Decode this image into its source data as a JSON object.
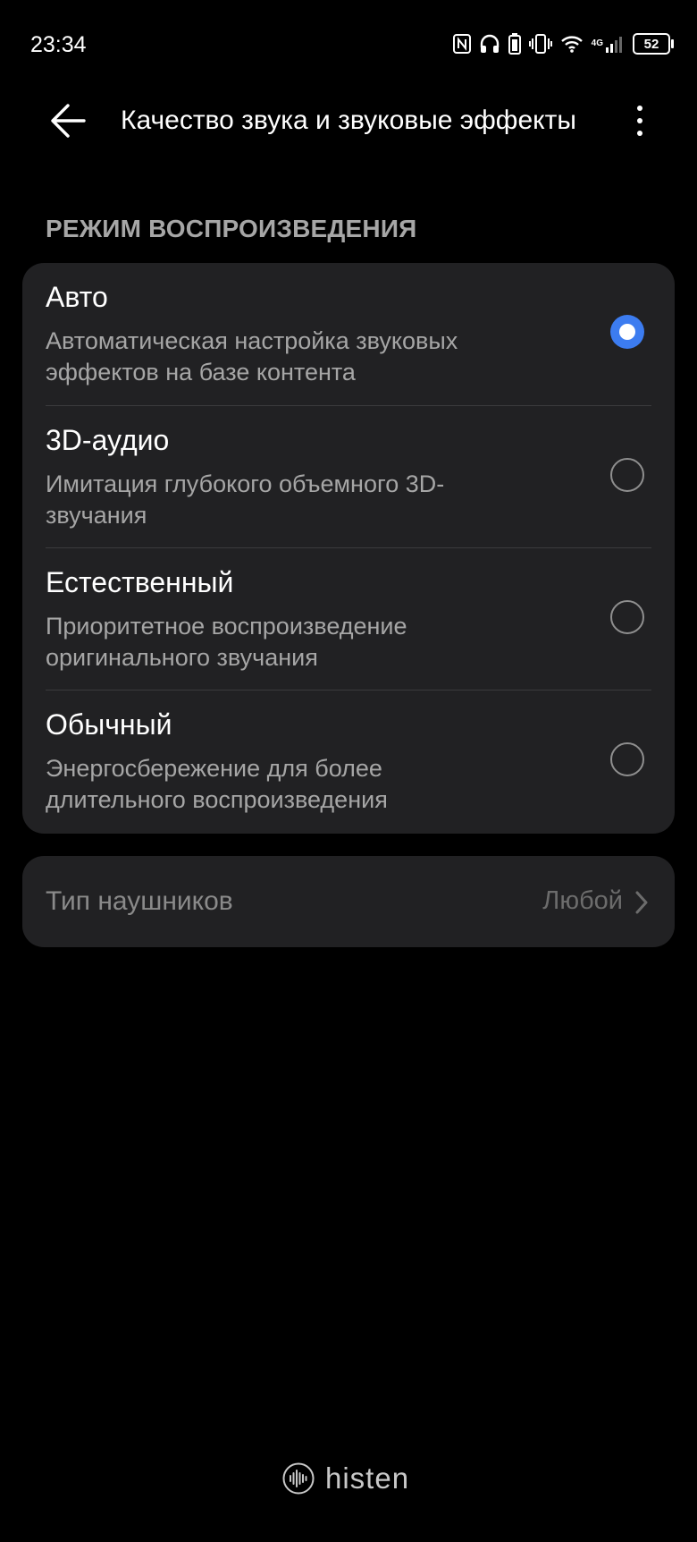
{
  "status_bar": {
    "time": "23:34",
    "network": "4G",
    "battery": "52",
    "icons": [
      "nfc-icon",
      "headphones-icon",
      "battery-saver-icon",
      "vibrate-icon",
      "wifi-icon",
      "signal-icon",
      "battery-icon"
    ]
  },
  "header": {
    "title": "Качество звука и звуковые эффекты",
    "back_icon": "arrow-left-icon",
    "more_icon": "more-vertical-icon"
  },
  "playback_mode": {
    "section_title": "РЕЖИМ ВОСПРОИЗВЕДЕНИЯ",
    "options": [
      {
        "title": "Авто",
        "description": "Автоматическая настройка звуковых эффектов на базе контента",
        "selected": true
      },
      {
        "title": "3D-аудио",
        "description": "Имитация глубокого объемного 3D-звучания",
        "selected": false
      },
      {
        "title": "Естественный",
        "description": "Приоритетное воспроизведение оригинального звучания",
        "selected": false
      },
      {
        "title": "Обычный",
        "description": "Энергосбережение для более длительного воспроизведения",
        "selected": false
      }
    ]
  },
  "headphones": {
    "label": "Тип наушников",
    "value": "Любой"
  },
  "brand": {
    "logo_text": "histen"
  },
  "colors": {
    "background": "#000000",
    "card": "#212123",
    "accent": "#3c7cf0",
    "secondary_text": "#a6a6a6"
  }
}
